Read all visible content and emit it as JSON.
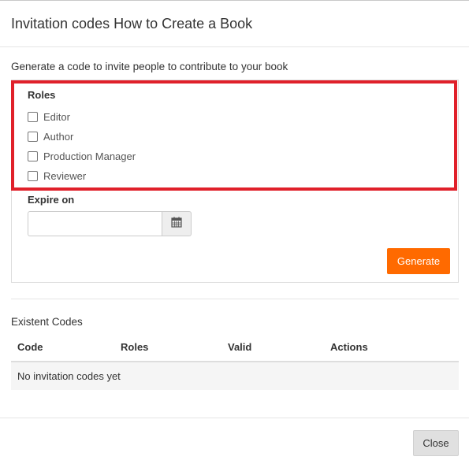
{
  "modal": {
    "title": "Invitation codes How to Create a Book"
  },
  "form": {
    "intro": "Generate a code to invite people to contribute to your book",
    "roles_label": "Roles",
    "roles": [
      {
        "label": "Editor",
        "checked": false
      },
      {
        "label": "Author",
        "checked": false
      },
      {
        "label": "Production Manager",
        "checked": false
      },
      {
        "label": "Reviewer",
        "checked": false
      }
    ],
    "expire_label": "Expire on",
    "expire_value": "",
    "calendar_icon": "calendar-icon",
    "generate_label": "Generate"
  },
  "existent": {
    "title": "Existent Codes",
    "columns": [
      "Code",
      "Roles",
      "Valid",
      "Actions"
    ],
    "empty_message": "No invitation codes yet"
  },
  "footer": {
    "close_label": "Close"
  },
  "colors": {
    "accent": "#ff6a00",
    "highlight": "#e0202a"
  }
}
